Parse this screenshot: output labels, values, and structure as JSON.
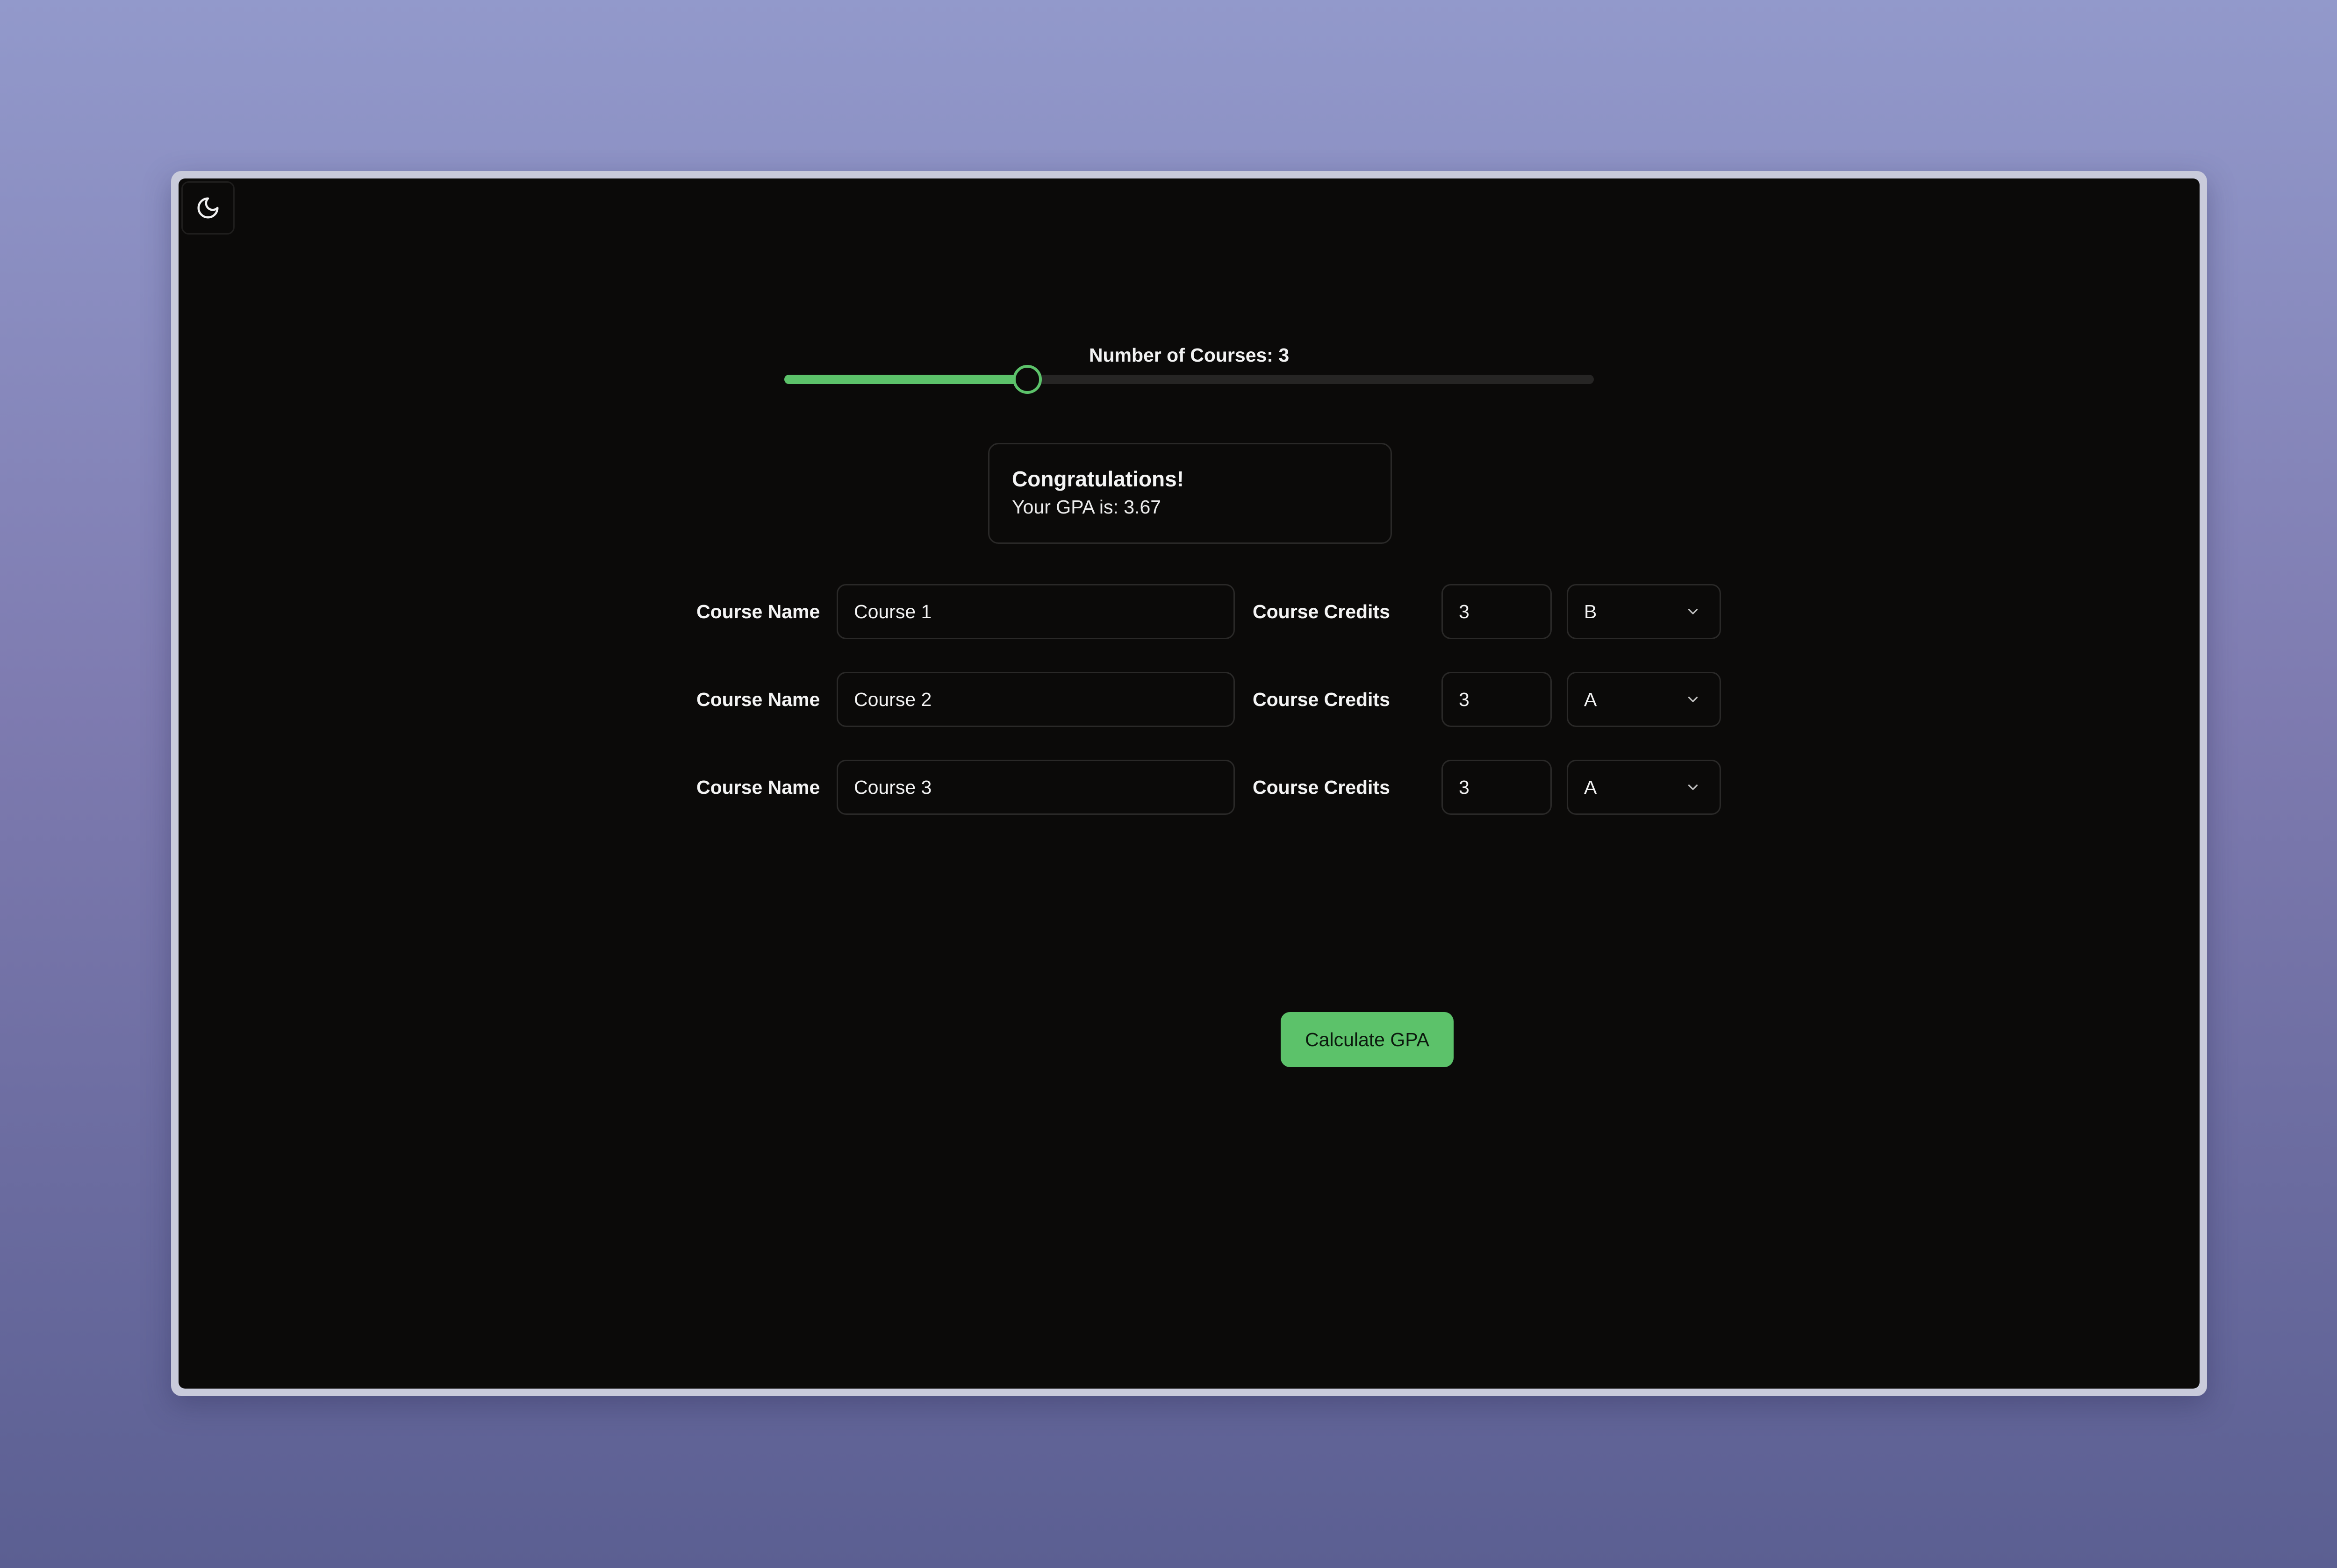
{
  "slider": {
    "label_prefix": "Number of Courses: ",
    "value": 3,
    "min": 1,
    "max": 10,
    "fill_fraction": 0.3,
    "label": "Number of Courses: 3"
  },
  "result": {
    "title": "Congratulations!",
    "text": "Your GPA is: 3.67"
  },
  "labels": {
    "course_name": "Course Name",
    "course_credits": "Course Credits"
  },
  "courses": [
    {
      "name": "Course 1",
      "credits": "3",
      "grade": "B"
    },
    {
      "name": "Course 2",
      "credits": "3",
      "grade": "A"
    },
    {
      "name": "Course 3",
      "credits": "3",
      "grade": "A"
    }
  ],
  "actions": {
    "calculate_label": "Calculate GPA"
  },
  "icons": {
    "theme_toggle": "moon-icon",
    "select_arrow": "chevron-down-icon"
  },
  "colors": {
    "accent": "#5cc26a",
    "surface": "#0b0a09",
    "border": "#2a2928",
    "text": "#f2f2f2"
  }
}
